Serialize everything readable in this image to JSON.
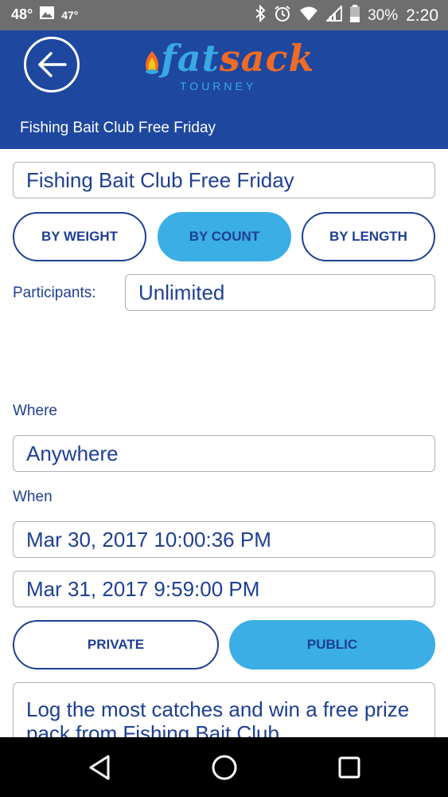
{
  "status_bar": {
    "temp_primary": "48°",
    "temp_secondary": "47°",
    "battery": "30%",
    "time": "2:20",
    "icons": [
      "image-icon",
      "bluetooth-icon",
      "alarm-icon",
      "wifi-icon",
      "signal-icon",
      "battery-icon"
    ]
  },
  "header": {
    "back_icon": "arrow-left-icon",
    "logo": {
      "word_a": "fat",
      "word_b": "sack",
      "subtitle": "TOURNEY"
    },
    "title": "Fishing Bait Club Free Friday"
  },
  "form": {
    "name_value": "Fishing Bait Club Free Friday",
    "scoring": {
      "weight": "BY WEIGHT",
      "count": "BY COUNT",
      "length": "BY LENGTH",
      "selected": "count"
    },
    "participants_label": "Participants:",
    "participants_value": "Unlimited",
    "where_label": "Where",
    "where_value": "Anywhere",
    "when_label": "When",
    "start": "Mar 30, 2017 10:00:36 PM",
    "end": "Mar 31, 2017 9:59:00 PM",
    "visibility": {
      "private": "PRIVATE",
      "public": "PUBLIC",
      "selected": "public"
    },
    "description": "Log the most catches and win a free prize pack from Fishing Bait Club"
  },
  "colors": {
    "header_bg": "#1e47a0",
    "accent": "#3aaee5",
    "text": "#1e3f93",
    "logo_orange": "#f06b24",
    "logo_blue": "#3aa8e2"
  },
  "nav_bar": {
    "icons": [
      "back-triangle-icon",
      "home-circle-icon",
      "recents-square-icon"
    ]
  }
}
